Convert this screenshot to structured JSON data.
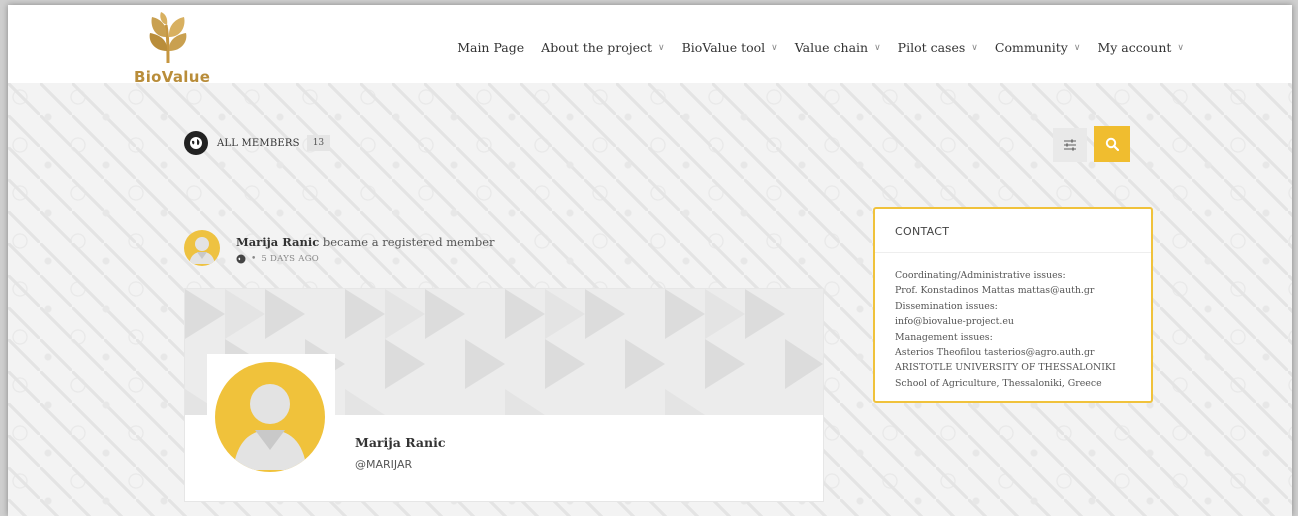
{
  "brand": {
    "name": "BioValue",
    "color": "#b98d3a"
  },
  "nav": {
    "items": [
      {
        "label": "Main Page",
        "dropdown": false
      },
      {
        "label": "About the project",
        "dropdown": true
      },
      {
        "label": "BioValue tool",
        "dropdown": true
      },
      {
        "label": "Value chain",
        "dropdown": true
      },
      {
        "label": "Pilot cases",
        "dropdown": true
      },
      {
        "label": "Community",
        "dropdown": true
      },
      {
        "label": "My account",
        "dropdown": true
      }
    ]
  },
  "members": {
    "label": "ALL MEMBERS",
    "count": "13"
  },
  "toolbar": {
    "filter_icon": "sliders-icon",
    "search_icon": "search-icon",
    "accent": "#f0bd2f"
  },
  "activity": {
    "user": "Marija Ranic",
    "action": "became a registered member",
    "time": "5 DAYS AGO"
  },
  "profile": {
    "name": "Marija Ranic",
    "handle": "@MARIJAR"
  },
  "contact": {
    "title": "CONTACT",
    "border_color": "#f0c23b",
    "lines": [
      "Coordinating/Administrative issues:",
      "Prof. Konstadinos Mattas mattas@auth.gr",
      "Dissemination issues:",
      "info@biovalue-project.eu",
      "Management issues:",
      "Asterios Theofilou tasterios@agro.auth.gr",
      "ARISTOTLE UNIVERSITY OF THESSALONIKI",
      "School of Agriculture, Thessaloniki, Greece"
    ]
  }
}
